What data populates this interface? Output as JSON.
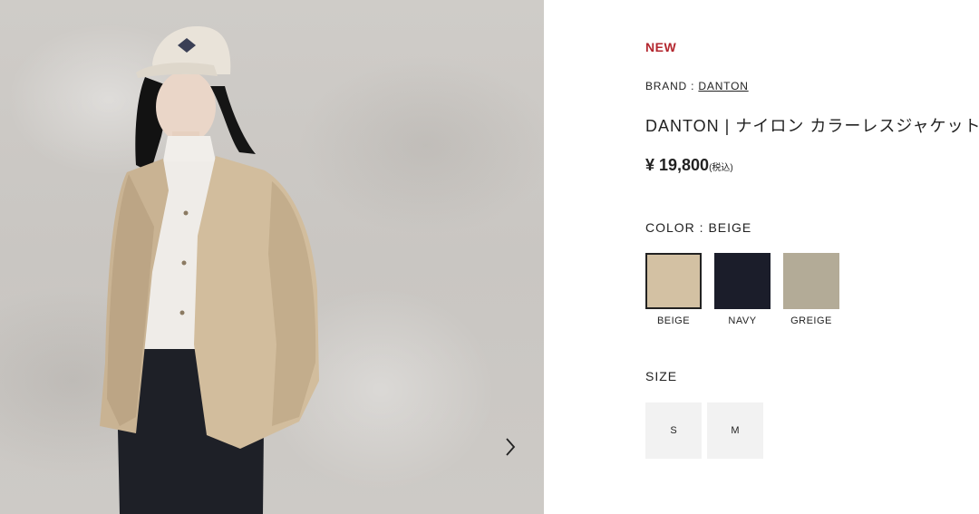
{
  "product": {
    "badge": "NEW",
    "brand_label": "BRAND :",
    "brand_name": "DANTON",
    "title": "DANTON | ナイロン カラーレスジャケット",
    "price": "¥ 19,800",
    "price_tax_note": "(税込)"
  },
  "color": {
    "label": "COLOR : BEIGE",
    "options": [
      {
        "name": "BEIGE",
        "hex": "#d3c1a3",
        "selected": true
      },
      {
        "name": "NAVY",
        "hex": "#1b1d2a",
        "selected": false
      },
      {
        "name": "GREIGE",
        "hex": "#b3ab97",
        "selected": false
      }
    ]
  },
  "size": {
    "label": "SIZE",
    "options": [
      "S",
      "M"
    ]
  },
  "gallery": {
    "next_icon": "chevron-right-icon"
  }
}
